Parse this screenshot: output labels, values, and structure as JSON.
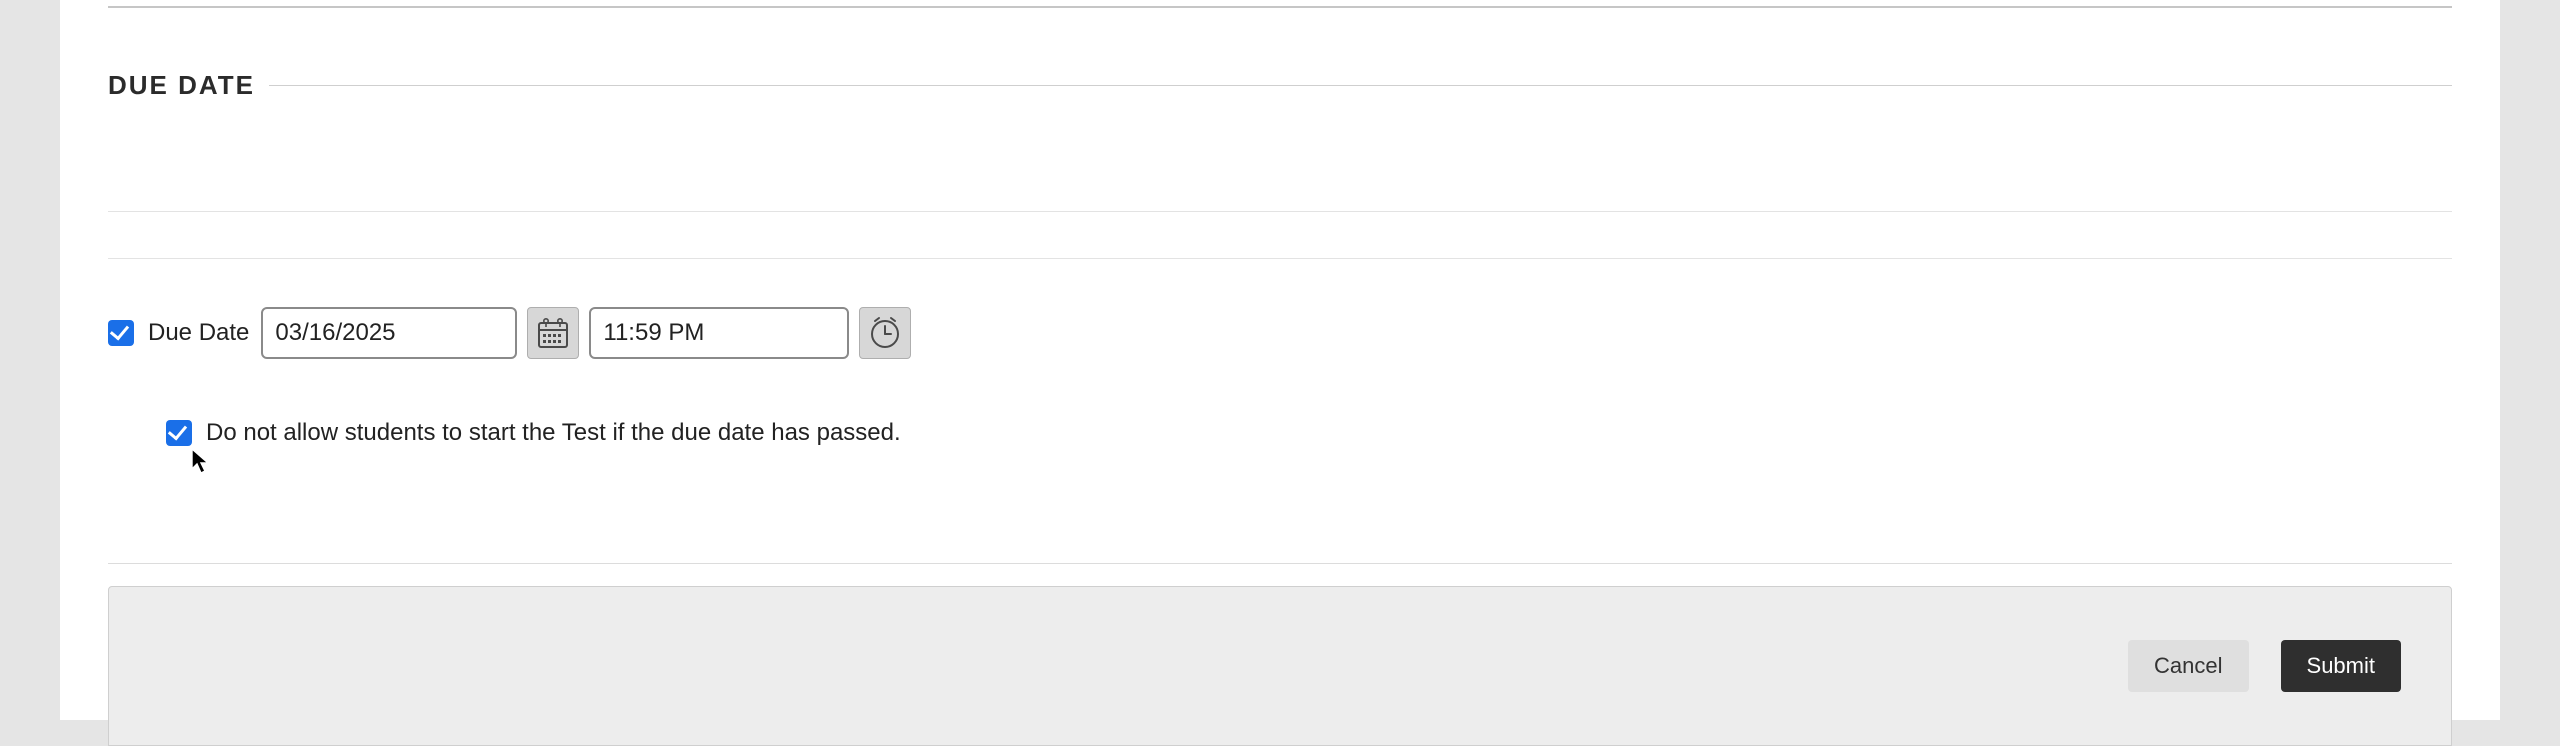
{
  "section": {
    "heading": "DUE DATE"
  },
  "dueDate": {
    "enabledLabel": "Due Date",
    "enabled": "true",
    "date": "03/16/2025",
    "time": "11:59 PM",
    "blockAfterDueLabel": "Do not allow students to start the Test if the due date has passed.",
    "blockAfterDue": "true"
  },
  "footer": {
    "cancel": "Cancel",
    "submit": "Submit"
  }
}
